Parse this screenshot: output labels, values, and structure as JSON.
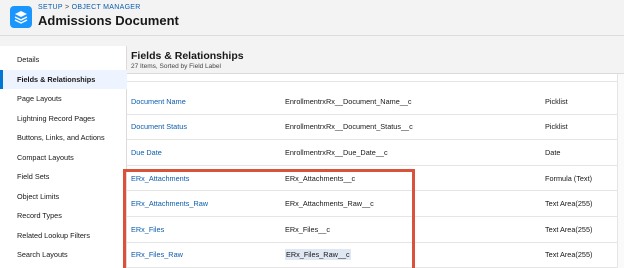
{
  "header": {
    "breadcrumb": {
      "setup": "SETUP",
      "sep": " > ",
      "object_manager": "OBJECT MANAGER"
    },
    "title": "Admissions Document",
    "icon": "layers-icon"
  },
  "sidebar": {
    "items": [
      {
        "label": "Details"
      },
      {
        "label": "Fields & Relationships",
        "active": true
      },
      {
        "label": "Page Layouts"
      },
      {
        "label": "Lightning Record Pages"
      },
      {
        "label": "Buttons, Links, and Actions"
      },
      {
        "label": "Compact Layouts"
      },
      {
        "label": "Field Sets"
      },
      {
        "label": "Object Limits"
      },
      {
        "label": "Record Types"
      },
      {
        "label": "Related Lookup Filters"
      },
      {
        "label": "Search Layouts"
      }
    ]
  },
  "main": {
    "title": "Fields & Relationships",
    "subtitle": "27 Items, Sorted by Field Label",
    "rows": [
      {
        "label": "Document Name",
        "api": "EnrollmentrxRx__Document_Name__c",
        "type": "Picklist"
      },
      {
        "label": "Document Status",
        "api": "EnrollmentrxRx__Document_Status__c",
        "type": "Picklist"
      },
      {
        "label": "Due Date",
        "api": "EnrollmentrxRx__Due_Date__c",
        "type": "Date"
      },
      {
        "label": "ERx_Attachments",
        "api": "ERx_Attachments__c",
        "type": "Formula (Text)"
      },
      {
        "label": "ERx_Attachments_Raw",
        "api": "ERx_Attachments_Raw__c",
        "type": "Text Area(255)"
      },
      {
        "label": "ERx_Files",
        "api": "ERx_Files__c",
        "type": "Text Area(255)"
      },
      {
        "label": "ERx_Files_Raw",
        "api": "ERx_Files_Raw__c",
        "type": "Text Area(255)"
      }
    ]
  },
  "colors": {
    "accent": "#0176d3",
    "link": "#0b5cab",
    "highlight_border": "#d9533c",
    "app_icon": "#1b96ff"
  }
}
